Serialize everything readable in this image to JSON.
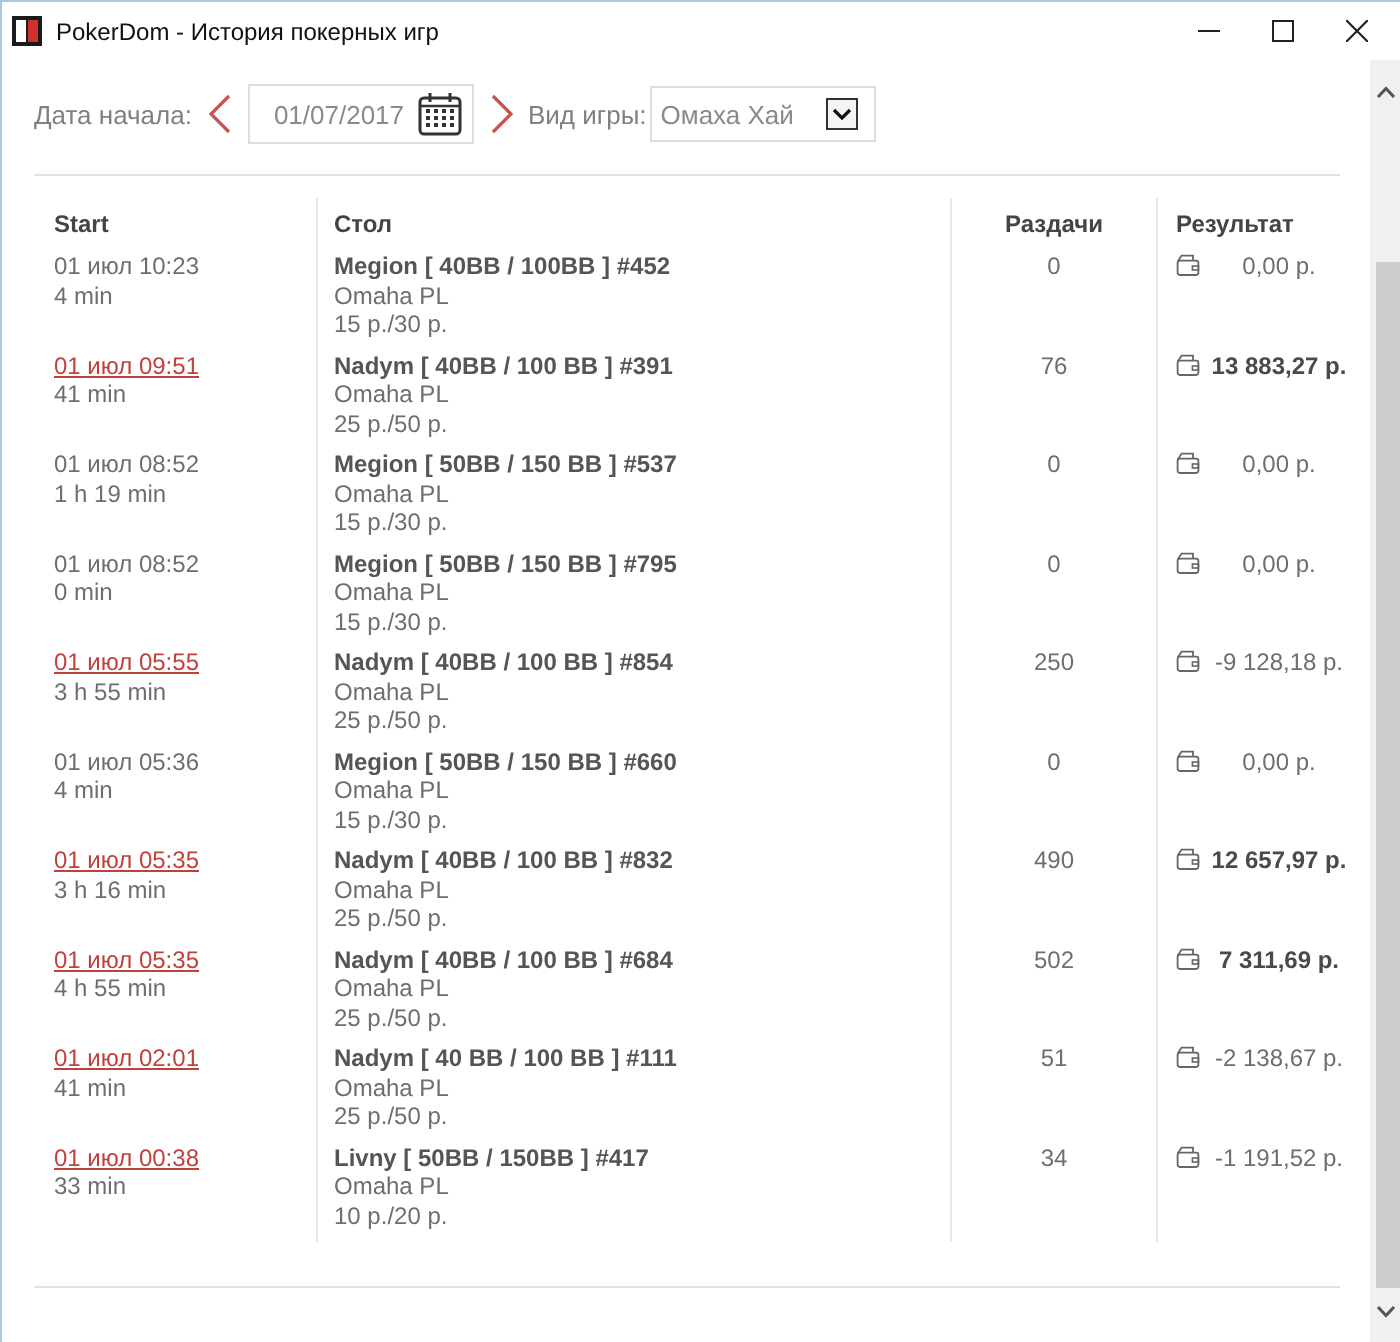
{
  "window": {
    "title": "PokerDom - История покерных игр"
  },
  "filters": {
    "date_label": "Дата начала:",
    "date_value": "01/07/2017",
    "game_label": "Вид игры:",
    "game_value": "Омаха Хай"
  },
  "table": {
    "columns": [
      "Start",
      "Стол",
      "Раздачи",
      "Результат"
    ],
    "rows": [
      {
        "start": "01 июл 10:23",
        "link": false,
        "duration": "4 min",
        "table": "Megion [ 40BB / 100BB ] #452",
        "game": "Omaha PL",
        "stakes": "15 р./30 р.",
        "hands": "0",
        "result": "0,00 р.",
        "win": false
      },
      {
        "start": "01 июл 09:51",
        "link": true,
        "duration": "41 min",
        "table": "Nadym [ 40BB / 100 BB ] #391",
        "game": "Omaha PL",
        "stakes": "25 р./50 р.",
        "hands": "76",
        "result": "13 883,27 р.",
        "win": true
      },
      {
        "start": "01 июл 08:52",
        "link": false,
        "duration": "1 h 19 min",
        "table": "Megion [ 50BB / 150 BB ] #537",
        "game": "Omaha PL",
        "stakes": "15 р./30 р.",
        "hands": "0",
        "result": "0,00 р.",
        "win": false
      },
      {
        "start": "01 июл 08:52",
        "link": false,
        "duration": "0 min",
        "table": "Megion [ 50BB / 150 BB ] #795",
        "game": "Omaha PL",
        "stakes": "15 р./30 р.",
        "hands": "0",
        "result": "0,00 р.",
        "win": false
      },
      {
        "start": "01 июл 05:55",
        "link": true,
        "duration": "3 h 55 min",
        "table": "Nadym [ 40BB / 100 BB ] #854",
        "game": "Omaha PL",
        "stakes": "25 р./50 р.",
        "hands": "250",
        "result": "-9 128,18 р.",
        "win": false
      },
      {
        "start": "01 июл 05:36",
        "link": false,
        "duration": "4 min",
        "table": "Megion [ 50BB / 150 BB ] #660",
        "game": "Omaha PL",
        "stakes": "15 р./30 р.",
        "hands": "0",
        "result": "0,00 р.",
        "win": false
      },
      {
        "start": "01 июл 05:35",
        "link": true,
        "duration": "3 h 16 min",
        "table": "Nadym [ 40BB / 100 BB ] #832",
        "game": "Omaha PL",
        "stakes": "25 р./50 р.",
        "hands": "490",
        "result": "12 657,97 р.",
        "win": true
      },
      {
        "start": "01 июл 05:35",
        "link": true,
        "duration": "4 h 55 min",
        "table": "Nadym [ 40BB / 100 BB ] #684",
        "game": "Omaha PL",
        "stakes": "25 р./50 р.",
        "hands": "502",
        "result": "7 311,69 р.",
        "win": true
      },
      {
        "start": "01 июл 02:01",
        "link": true,
        "duration": "41 min",
        "table": "Nadym [ 40 BB / 100 BB ] #111",
        "game": "Omaha PL",
        "stakes": "25 р./50 р.",
        "hands": "51",
        "result": "-2 138,67 р.",
        "win": false
      },
      {
        "start": "01 июл 00:38",
        "link": true,
        "duration": "33 min",
        "table": "Livny [ 50BB / 150BB ] #417",
        "game": "Omaha PL",
        "stakes": "10 р./20 р.",
        "hands": "34",
        "result": "-1 191,52 р.",
        "win": false
      }
    ]
  }
}
